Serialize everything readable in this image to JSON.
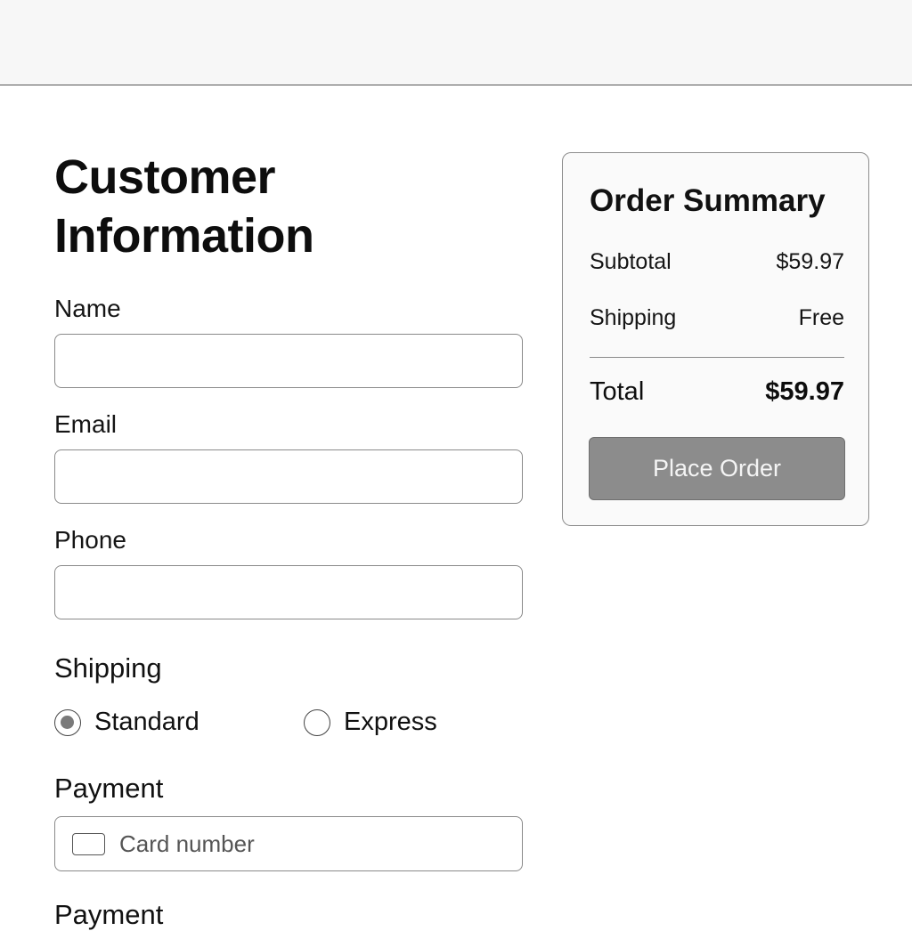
{
  "form": {
    "title": "Customer Information",
    "name_label": "Name",
    "name_value": "",
    "email_label": "Email",
    "email_value": "",
    "phone_label": "Phone",
    "phone_value": "",
    "shipping": {
      "label": "Shipping",
      "options": [
        {
          "label": "Standard",
          "selected": true
        },
        {
          "label": "Express",
          "selected": false
        }
      ]
    },
    "payment": {
      "label": "Payment",
      "card_placeholder": "Card number",
      "card_icon": "credit-card-icon"
    },
    "next_section_label": "Payment"
  },
  "summary": {
    "title": "Order Summary",
    "subtotal_label": "Subtotal",
    "subtotal_value": "$59.97",
    "shipping_label": "Shipping",
    "shipping_value": "Free",
    "total_label": "Total",
    "total_value": "$59.97",
    "place_order_label": "Place Order"
  },
  "colors": {
    "button_bg": "#8c8c8c",
    "radio_fill": "#7a7a7a",
    "border": "#8a8a8a"
  }
}
